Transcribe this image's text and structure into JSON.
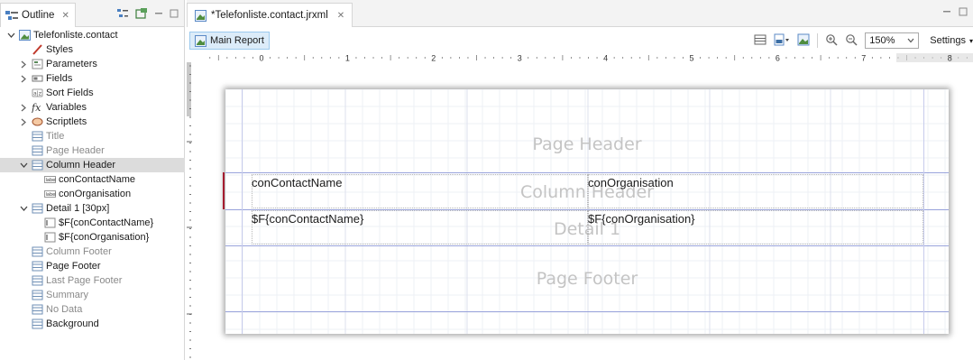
{
  "outline": {
    "tab_label": "Outline",
    "tab_close": "✕",
    "tree": [
      {
        "label": "Telefonliste.contact",
        "indent": 0,
        "twisty": "open",
        "icon": "report-icon",
        "muted": false
      },
      {
        "label": "Styles",
        "indent": 1,
        "twisty": "",
        "icon": "styles-icon",
        "muted": false
      },
      {
        "label": "Parameters",
        "indent": 1,
        "twisty": "closed",
        "icon": "parameters-icon",
        "muted": false
      },
      {
        "label": "Fields",
        "indent": 1,
        "twisty": "closed",
        "icon": "fields-icon",
        "muted": false
      },
      {
        "label": "Sort Fields",
        "indent": 1,
        "twisty": "",
        "icon": "sort-fields-icon",
        "muted": false
      },
      {
        "label": "Variables",
        "indent": 1,
        "twisty": "closed",
        "icon": "variables-icon",
        "muted": false
      },
      {
        "label": "Scriptlets",
        "indent": 1,
        "twisty": "closed",
        "icon": "scriptlets-icon",
        "muted": false
      },
      {
        "label": "Title",
        "indent": 1,
        "twisty": "",
        "icon": "band-icon",
        "muted": true
      },
      {
        "label": "Page Header",
        "indent": 1,
        "twisty": "",
        "icon": "band-icon",
        "muted": true
      },
      {
        "label": "Column Header",
        "indent": 1,
        "twisty": "open",
        "icon": "band-icon",
        "muted": false,
        "selected": true
      },
      {
        "label": "conContactName",
        "indent": 2,
        "twisty": "",
        "icon": "label-icon",
        "muted": false
      },
      {
        "label": "conOrganisation",
        "indent": 2,
        "twisty": "",
        "icon": "label-icon",
        "muted": false
      },
      {
        "label": "Detail 1 [30px]",
        "indent": 1,
        "twisty": "open",
        "icon": "band-icon",
        "muted": false
      },
      {
        "label": "$F{conContactName}",
        "indent": 2,
        "twisty": "",
        "icon": "textfield-icon",
        "muted": false
      },
      {
        "label": "$F{conOrganisation}",
        "indent": 2,
        "twisty": "",
        "icon": "textfield-icon",
        "muted": false
      },
      {
        "label": "Column Footer",
        "indent": 1,
        "twisty": "",
        "icon": "band-icon",
        "muted": true
      },
      {
        "label": "Page Footer",
        "indent": 1,
        "twisty": "",
        "icon": "band-icon",
        "muted": false
      },
      {
        "label": "Last Page Footer",
        "indent": 1,
        "twisty": "",
        "icon": "band-icon",
        "muted": true
      },
      {
        "label": "Summary",
        "indent": 1,
        "twisty": "",
        "icon": "band-icon",
        "muted": true
      },
      {
        "label": "No Data",
        "indent": 1,
        "twisty": "",
        "icon": "band-icon",
        "muted": true
      },
      {
        "label": "Background",
        "indent": 1,
        "twisty": "",
        "icon": "band-icon",
        "muted": false
      }
    ]
  },
  "editor": {
    "tab_label": "*Telefonliste.contact.jrxml",
    "tab_close": "✕",
    "main_report_label": "Main Report",
    "zoom_value": "150%",
    "settings_label": "Settings",
    "ruler_numbers": [
      "0",
      "1",
      "2",
      "3",
      "4",
      "5",
      "6",
      "7",
      "8"
    ],
    "band_labels": {
      "page_header": "Page Header",
      "column_header": "Column Header",
      "detail": "Detail 1",
      "page_footer": "Page Footer"
    },
    "fields": {
      "col_header_name": "conContactName",
      "col_header_org": "conOrganisation",
      "detail_name": "$F{conContactName}",
      "detail_org": "$F{conOrganisation}"
    }
  },
  "colors": {
    "band_line": "#9aa4dc",
    "selection": "#dcdcdc",
    "accent_button": "#dcecf9",
    "band_label_text": "#c4c4c4",
    "marker": "#a51c30"
  }
}
